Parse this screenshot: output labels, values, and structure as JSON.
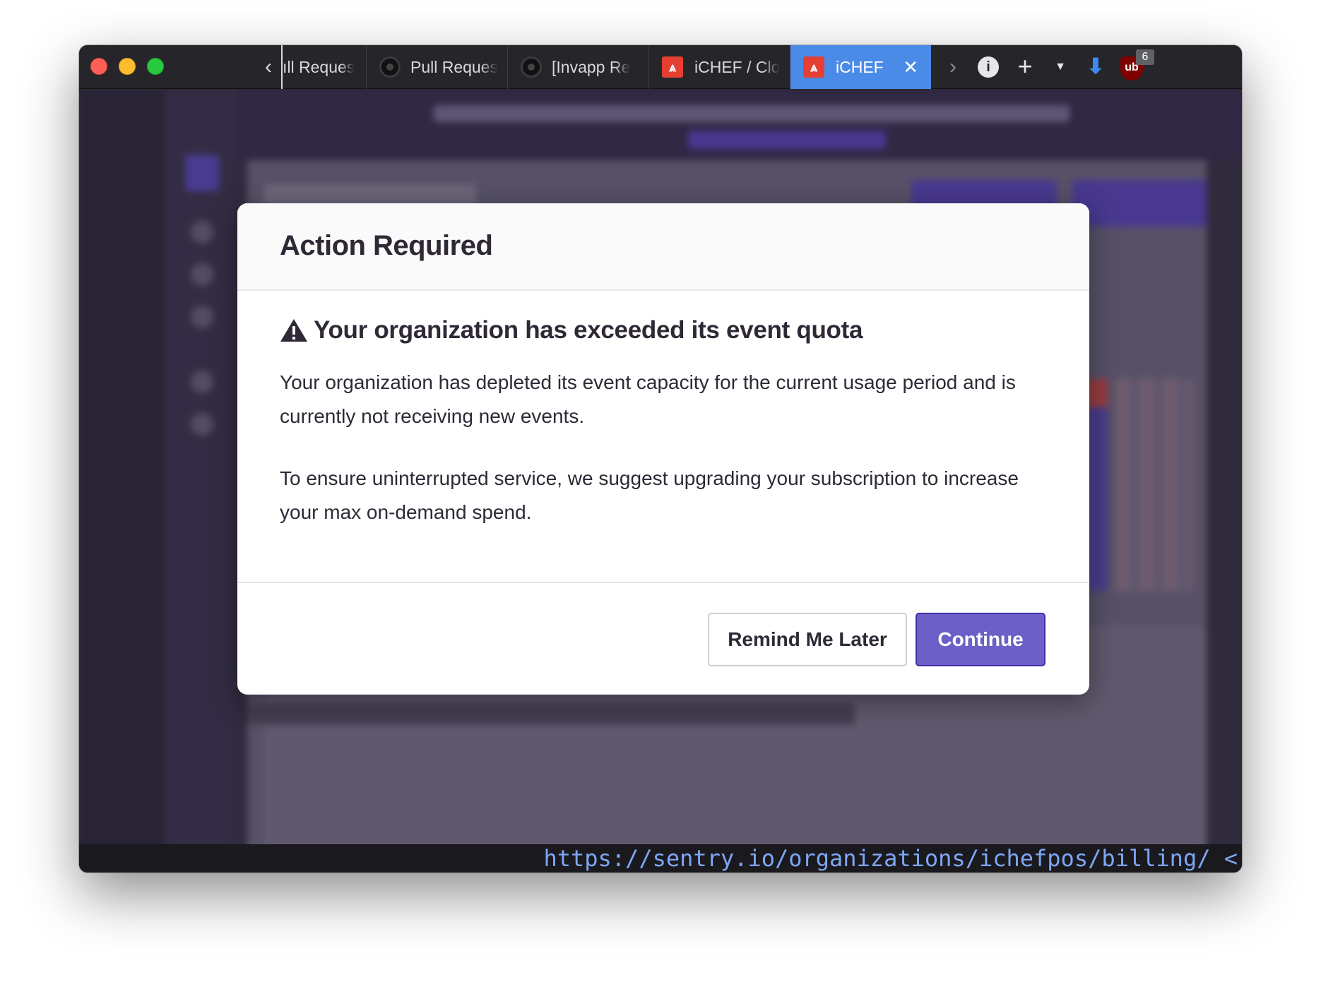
{
  "browser": {
    "tabs": [
      {
        "label": "ıll Reques",
        "icon": "github-icon",
        "active": false
      },
      {
        "label": "Pull Reques",
        "icon": "github-icon",
        "active": false
      },
      {
        "label": "[Invapp Re",
        "icon": "github-icon",
        "active": false
      },
      {
        "label": "iCHEF / Clo",
        "icon": "sentry-icon",
        "active": false
      },
      {
        "label": "iCHEF",
        "icon": "sentry-icon",
        "active": true
      }
    ],
    "close_tab_glyph": "✕",
    "back_glyph": "‹",
    "forward_glyph": "›",
    "new_tab_glyph": "+",
    "extension_badge_count": "6",
    "accent_color": "#4a8be8",
    "status_url": "https://sentry.io/organizations/ichefpos/billing/ <"
  },
  "modal": {
    "title": "Action Required",
    "heading": "Your organization has exceeded its event quota",
    "paragraph_1": "Your organization has depleted its event capacity for the current usage period and is currently not receiving new events.",
    "paragraph_2": "To ensure uninterrupted service, we suggest upgrading your subscription to increase your max on-demand spend.",
    "secondary_button": "Remind Me Later",
    "primary_button": "Continue",
    "primary_color": "#6c5fc7"
  }
}
